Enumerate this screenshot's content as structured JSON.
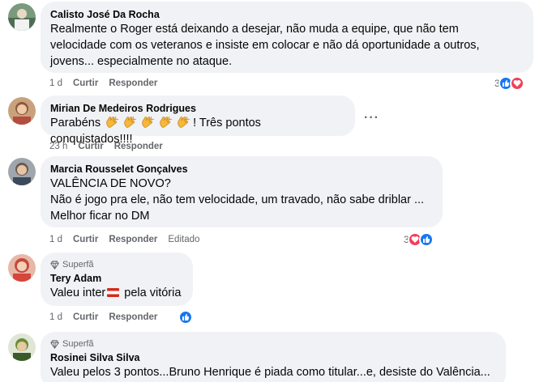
{
  "comments": [
    {
      "author": "Calisto José Da Rocha",
      "lines": [
        "Realmente o Roger está deixando a desejar, não muda a equipe, que não tem",
        "velocidade com os veteranos e insiste em colocar e não dá oportunidade a outros,",
        "jovens... especialmente no ataque."
      ],
      "time": "1 d",
      "like_label": "Curtir",
      "reply_label": "Responder",
      "reaction_count": "3",
      "reactions": [
        "like-icon",
        "love-icon"
      ]
    },
    {
      "author": "Mirian De Medeiros Rodrigues",
      "text_before": "Parabéns",
      "emoji": "clapping-hands",
      "emoji_count": 5,
      "text_after": "! Três pontos conquistados!!!!",
      "time": "23 h",
      "like_label": "Curtir",
      "reply_label": "Responder",
      "more_label": "···"
    },
    {
      "author": "Marcia Rousselet Gonçalves",
      "lines": [
        "VALÊNCIA DE NOVO?",
        "Não é jogo pra ele, não tem velocidade, um travado, não sabe driblar ...",
        "Melhor ficar no DM"
      ],
      "time": "1 d",
      "like_label": "Curtir",
      "reply_label": "Responder",
      "edited_label": "Editado",
      "reaction_count": "3",
      "reactions": [
        "love-icon",
        "like-icon"
      ]
    },
    {
      "badge": "Superfã",
      "author": "Tery Adam",
      "text_before": "Valeu inter",
      "text_after": " pela vitória",
      "time": "1 d",
      "like_label": "Curtir",
      "reply_label": "Responder",
      "reactions": [
        "like-icon"
      ]
    },
    {
      "badge": "Superfã",
      "author": "Rosinei Silva Silva",
      "lines": [
        "Valeu pelos 3 pontos...Bruno Henrique é piada como titular...e, desiste do Valência..."
      ]
    }
  ],
  "colors": {
    "bubble": "#f0f2f5",
    "like": "#1877f2",
    "love": "#f33e58",
    "meta": "#65676b"
  }
}
